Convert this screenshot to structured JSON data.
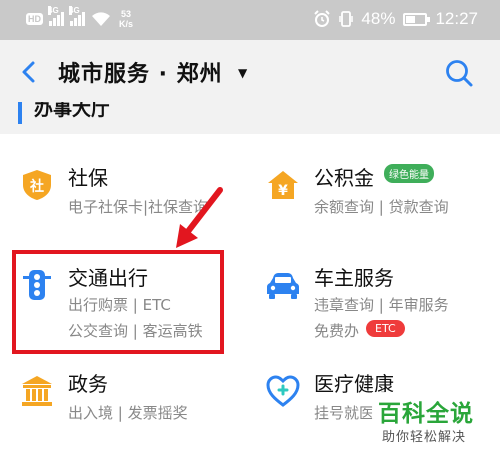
{
  "status_bar": {
    "hd": "HD",
    "net1": "4G",
    "net2": "4G",
    "speed_value": "53",
    "speed_unit": "K/s",
    "battery_text": "48%",
    "battery_level": 0.48,
    "time": "12:27"
  },
  "header": {
    "title": "城市服务 · 郑州"
  },
  "section": {
    "title": "办事大厅"
  },
  "services": [
    {
      "name": "社保",
      "sub1": "电子社保卡|社保查询",
      "icon": "shield-icon",
      "color": "#f5a623"
    },
    {
      "name": "公积金",
      "badge": "绿色能量",
      "sub1": "余额查询 | 贷款查询",
      "icon": "yuan-house-icon",
      "color": "#f5a623"
    },
    {
      "name": "交通出行",
      "sub1": "出行购票 | ETC",
      "sub2": "公交查询 | 客运高铁",
      "icon": "traffic-light-icon",
      "color": "#2d82f0"
    },
    {
      "name": "车主服务",
      "sub1": "违章查询 | 年审服务",
      "sub2": "免费办",
      "badge": "ETC",
      "icon": "car-icon",
      "color": "#2d82f0"
    },
    {
      "name": "政务",
      "sub1": "出入境 | 发票摇奖",
      "icon": "government-building-icon",
      "color": "#f5a623"
    },
    {
      "name": "医疗健康",
      "sub1": "挂号就医",
      "icon": "medical-cross-icon",
      "color": "#2d82f0"
    }
  ],
  "watermark": {
    "main": "百科全说",
    "sub": "助你轻松解决"
  },
  "colors": {
    "accent_blue": "#2d82f0",
    "accent_orange": "#f5a623",
    "highlight_red": "#e2161f",
    "badge_green": "#3fae5a",
    "badge_red": "#ef3b3b"
  }
}
